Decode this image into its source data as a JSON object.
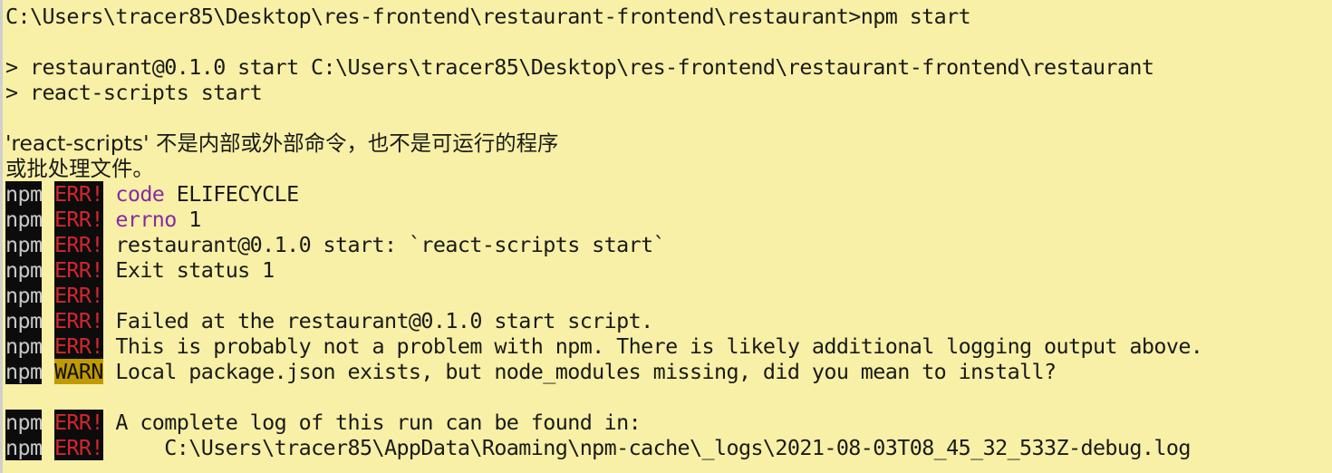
{
  "colors": {
    "background": "#f8f0a6",
    "text": "#1a1a1a",
    "npm_tag_bg": "#0c0c0c",
    "err_text": "#d4262d",
    "warn_bg": "#c09a00",
    "keyword": "#8a2aa3"
  },
  "terminal": {
    "lines": [
      {
        "type": "plain",
        "text": "C:\\Users\\tracer85\\Desktop\\res-frontend\\restaurant-frontend\\restaurant>npm start"
      },
      {
        "type": "blank"
      },
      {
        "type": "plain",
        "text": "> restaurant@0.1.0 start C:\\Users\\tracer85\\Desktop\\res-frontend\\restaurant-frontend\\restaurant"
      },
      {
        "type": "plain",
        "text": "> react-scripts start"
      },
      {
        "type": "blank"
      },
      {
        "type": "cjk",
        "text": "'react-scripts' 不是内部或外部命令，也不是可运行的程序"
      },
      {
        "type": "cjk",
        "text": "或批处理文件。"
      },
      {
        "type": "npm",
        "tag": "npm",
        "level": "ERR!",
        "key": "code",
        "text": "ELIFECYCLE"
      },
      {
        "type": "npm",
        "tag": "npm",
        "level": "ERR!",
        "key": "errno",
        "text": "1"
      },
      {
        "type": "npm",
        "tag": "npm",
        "level": "ERR!",
        "key": "",
        "text": "restaurant@0.1.0 start: `react-scripts start`"
      },
      {
        "type": "npm",
        "tag": "npm",
        "level": "ERR!",
        "key": "",
        "text": "Exit status 1"
      },
      {
        "type": "npm",
        "tag": "npm",
        "level": "ERR!",
        "key": "",
        "text": ""
      },
      {
        "type": "npm",
        "tag": "npm",
        "level": "ERR!",
        "key": "",
        "text": "Failed at the restaurant@0.1.0 start script."
      },
      {
        "type": "npm",
        "tag": "npm",
        "level": "ERR!",
        "key": "",
        "text": "This is probably not a problem with npm. There is likely additional logging output above."
      },
      {
        "type": "npm",
        "tag": "npm",
        "level": "WARN",
        "key": "",
        "text": "Local package.json exists, but node_modules missing, did you mean to install?"
      },
      {
        "type": "blank"
      },
      {
        "type": "npm",
        "tag": "npm",
        "level": "ERR!",
        "key": "",
        "text": "A complete log of this run can be found in:"
      },
      {
        "type": "npm",
        "tag": "npm",
        "level": "ERR!",
        "key": "",
        "text": "    C:\\Users\\tracer85\\AppData\\Roaming\\npm-cache\\_logs\\2021-08-03T08_45_32_533Z-debug.log"
      }
    ]
  }
}
